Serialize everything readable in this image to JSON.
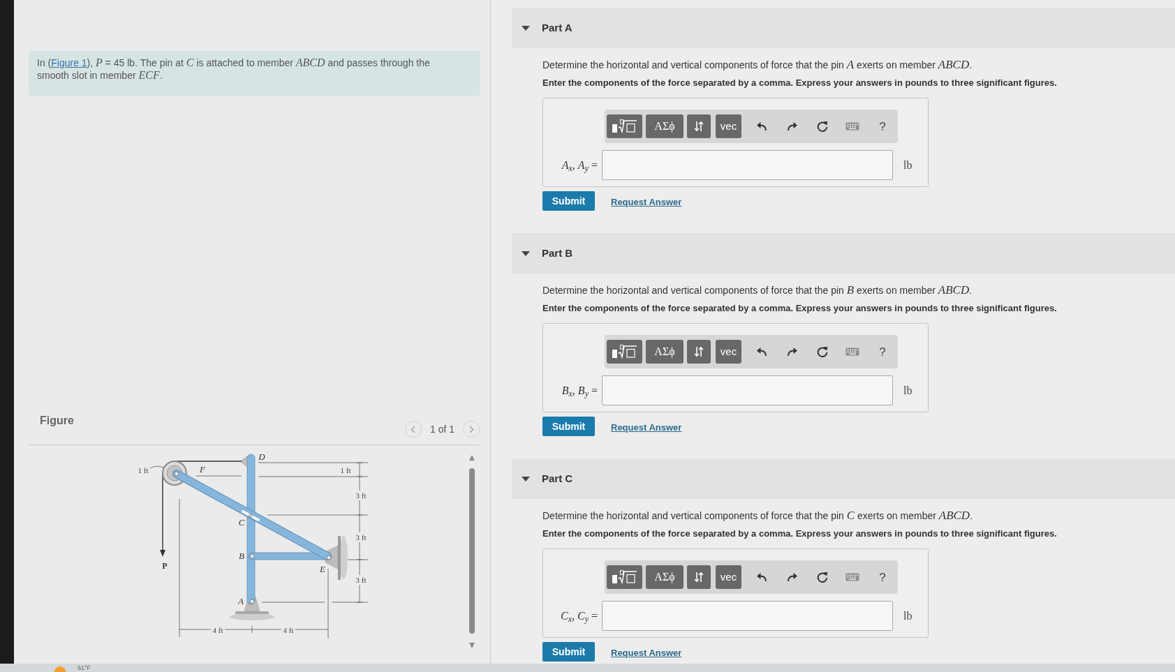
{
  "problem": {
    "prefix": "In (",
    "link": "Figure 1",
    "text": "), *P* = 45 lb. The pin at *C* is attached to member *ABCD* and passes through the smooth slot in member *ECF*."
  },
  "figure": {
    "title": "Figure",
    "pager": "1 of 1",
    "labels": [
      {
        "text": "D",
        "kind": "point"
      },
      {
        "text": "1 ft",
        "kind": "dimension"
      },
      {
        "text": "F",
        "kind": "point"
      },
      {
        "text": "1 ft",
        "kind": "dimension"
      },
      {
        "text": "3 ft",
        "kind": "dimension"
      },
      {
        "text": "C",
        "kind": "point"
      },
      {
        "text": "3 ft",
        "kind": "dimension"
      },
      {
        "text": "B",
        "kind": "point"
      },
      {
        "text": "P",
        "kind": "load"
      },
      {
        "text": "E",
        "kind": "point"
      },
      {
        "text": "3 ft",
        "kind": "dimension"
      },
      {
        "text": "A",
        "kind": "point"
      },
      {
        "text": "4 ft",
        "kind": "dimension"
      },
      {
        "text": "4 ft",
        "kind": "dimension"
      }
    ]
  },
  "parts": [
    {
      "title": "Part A",
      "expanded": true,
      "question": "Determine the horizontal and vertical components of force that the pin *A* exerts on member *ABCD*.",
      "instruction": "Enter the components of the force separated by a comma. Express your answers in pounds to three significant figures.",
      "toolbar": {
        "symbols": "ΑΣϕ",
        "vector": "vec",
        "help": "?"
      },
      "answer_label": "*A*$_{x}$, *A*$_{y}$ =",
      "unit": "lb",
      "submit": "Submit",
      "request_answer": "Request Answer"
    },
    {
      "title": "Part B",
      "expanded": true,
      "question": "Determine the horizontal and vertical components of force that the pin *B* exerts on member *ABCD*.",
      "instruction": "Enter the components of the force separated by a comma. Express your answers in pounds to three significant figures.",
      "toolbar": {
        "symbols": "ΑΣϕ",
        "vector": "vec",
        "help": "?"
      },
      "answer_label": "*B*$_{x}$, *B*$_{y}$ =",
      "unit": "lb",
      "submit": "Submit",
      "request_answer": "Request Answer"
    },
    {
      "title": "Part C",
      "expanded": true,
      "question": "Determine the horizontal and vertical components of force that the pin *C* exerts on member *ABCD*.",
      "instruction": "Enter the components of the force separated by a comma. Express your answers in pounds to three significant figures.",
      "toolbar": {
        "symbols": "ΑΣϕ",
        "vector": "vec",
        "help": "?"
      },
      "answer_label": "*C*$_{x}$, *C*$_{y}$ =",
      "unit": "lb",
      "submit": "Submit",
      "request_answer": "Request Answer"
    }
  ],
  "taskbar": {
    "weather": "61°F"
  }
}
